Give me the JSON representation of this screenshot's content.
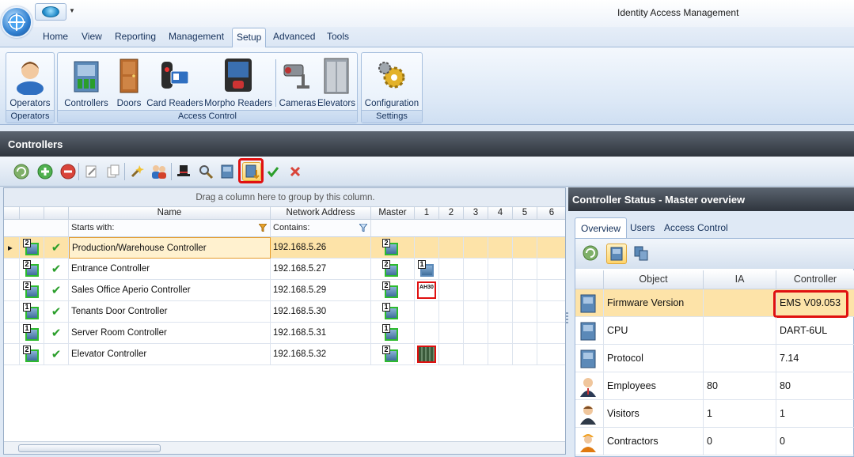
{
  "window": {
    "title": "Identity Access Management"
  },
  "ribbon_tabs": [
    "Home",
    "View",
    "Reporting",
    "Management",
    "Setup",
    "Advanced",
    "Tools"
  ],
  "ribbon_active_tab": "Setup",
  "ribbon_groups": {
    "operators": {
      "label": "Operators",
      "buttons": [
        "Operators"
      ]
    },
    "access_control": {
      "label": "Access Control",
      "buttons": [
        "Controllers",
        "Doors",
        "Card Readers",
        "Morpho Readers",
        "Cameras",
        "Elevators"
      ]
    },
    "settings": {
      "label": "Settings",
      "buttons": [
        "Configuration"
      ]
    }
  },
  "section": {
    "title": "Controllers"
  },
  "toolbar_icons": [
    "refresh-icon",
    "add-icon",
    "delete-icon",
    "edit-icon",
    "copy-icon",
    "wizard-icon",
    "users-icon",
    "hat-icon",
    "search-icon",
    "controller-icon",
    "controller-download-icon",
    "apply-icon",
    "cancel-icon"
  ],
  "grid": {
    "group_hint": "Drag a column here to group by this column.",
    "columns": {
      "name": "Name",
      "network_address": "Network Address",
      "master": "Master",
      "c1": "1",
      "c2": "2",
      "c3": "3",
      "c4": "4",
      "c5": "5",
      "c6": "6"
    },
    "filters": {
      "name": "Starts with:",
      "network_address": "Contains:"
    },
    "rows": [
      {
        "badge": "2",
        "name": "Production/Warehouse Controller",
        "address": "192.168.5.26",
        "master_badge": "2",
        "c1": "",
        "selected": true
      },
      {
        "badge": "2",
        "name": "Entrance Controller",
        "address": "192.168.5.27",
        "master_badge": "2",
        "c1": "1"
      },
      {
        "badge": "2",
        "name": "Sales Office Aperio Controller",
        "address": "192.168.5.29",
        "master_badge": "2",
        "c1": "AH30"
      },
      {
        "badge": "1",
        "name": "Tenants Door Controller",
        "address": "192.168.5.30",
        "master_badge": "1",
        "c1": ""
      },
      {
        "badge": "1",
        "name": "Server Room Controller",
        "address": "192.168.5.31",
        "master_badge": "1",
        "c1": ""
      },
      {
        "badge": "2",
        "name": "Elevator Controller",
        "address": "192.168.5.32",
        "master_badge": "2",
        "c1": "board"
      }
    ]
  },
  "status_panel": {
    "title": "Controller Status - Master overview",
    "tabs": [
      "Overview",
      "Users",
      "Access Control"
    ],
    "active_tab": "Overview",
    "columns": {
      "object": "Object",
      "ia": "IA",
      "controller": "Controller"
    },
    "rows": [
      {
        "icon": "controller-icon",
        "object": "Firmware Version",
        "ia": "",
        "controller": "EMS V09.053",
        "selected": true
      },
      {
        "icon": "controller-icon",
        "object": "CPU",
        "ia": "",
        "controller": "DART-6UL"
      },
      {
        "icon": "controller-icon",
        "object": "Protocol",
        "ia": "",
        "controller": "7.14"
      },
      {
        "icon": "employee-icon",
        "object": "Employees",
        "ia": "80",
        "controller": "80"
      },
      {
        "icon": "visitor-icon",
        "object": "Visitors",
        "ia": "1",
        "controller": "1"
      },
      {
        "icon": "contractor-icon",
        "object": "Contractors",
        "ia": "0",
        "controller": "0"
      }
    ]
  },
  "colors": {
    "highlight": "#e01010",
    "selected_row": "#fde3a8",
    "header_dark": "#2f353d",
    "check": "#2a9e2a"
  }
}
